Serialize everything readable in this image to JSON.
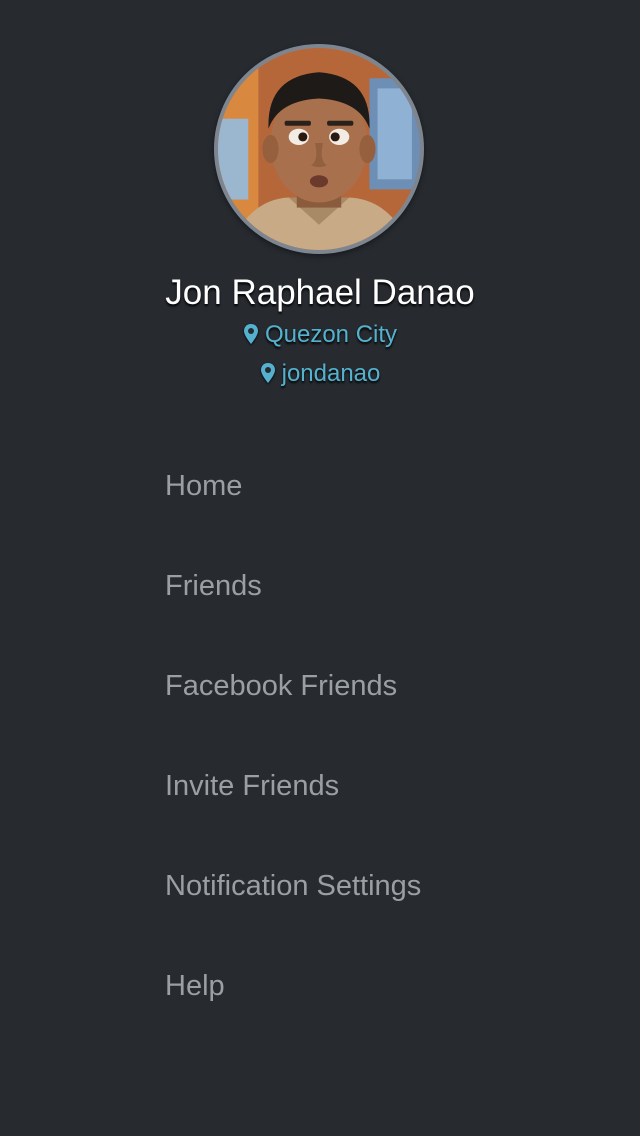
{
  "profile": {
    "name": "Jon Raphael Danao",
    "location": "Quezon City",
    "username": "jondanao",
    "avatar_icon": "user-avatar-photo",
    "location_icon": "map-pin-icon",
    "username_icon": "map-pin-icon"
  },
  "menu": {
    "items": [
      {
        "label": "Home"
      },
      {
        "label": "Friends"
      },
      {
        "label": "Facebook Friends"
      },
      {
        "label": "Invite Friends"
      },
      {
        "label": "Notification Settings"
      },
      {
        "label": "Help"
      }
    ]
  },
  "colors": {
    "background": "#272b30",
    "name_text": "#ffffff",
    "accent": "#55b2cf",
    "menu_text": "#9a9fa4",
    "avatar_border": "#7d8690"
  }
}
